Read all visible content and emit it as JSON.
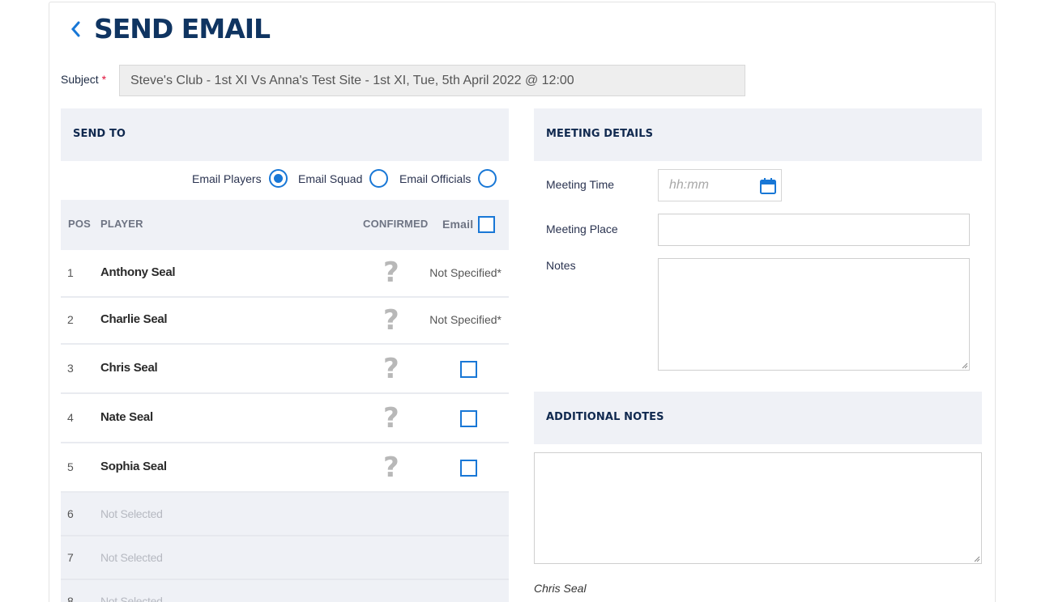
{
  "page": {
    "title": "SEND EMAIL"
  },
  "subject": {
    "label": "Subject",
    "required_mark": "*",
    "value": "Steve's Club - 1st XI Vs Anna's Test Site - 1st XI, Tue, 5th April 2022 @ 12:00"
  },
  "send_to": {
    "heading": "SEND TO",
    "options": [
      {
        "label": "Email Players",
        "selected": true
      },
      {
        "label": "Email Squad",
        "selected": false
      },
      {
        "label": "Email Officials",
        "selected": false
      }
    ],
    "columns": {
      "pos": "POS",
      "player": "PLAYER",
      "confirmed": "CONFIRMED",
      "email": "Email"
    },
    "rows": [
      {
        "pos": "1",
        "name": "Anthony Seal",
        "confirmed": "?",
        "email": "Not Specified*"
      },
      {
        "pos": "2",
        "name": "Charlie Seal",
        "confirmed": "?",
        "email": "Not Specified*"
      },
      {
        "pos": "3",
        "name": "Chris Seal",
        "confirmed": "?",
        "email": ""
      },
      {
        "pos": "4",
        "name": "Nate Seal",
        "confirmed": "?",
        "email": ""
      },
      {
        "pos": "5",
        "name": "Sophia Seal",
        "confirmed": "?",
        "email": ""
      },
      {
        "pos": "6",
        "name": "Not Selected"
      },
      {
        "pos": "7",
        "name": "Not Selected"
      },
      {
        "pos": "8",
        "name": "Not Selected"
      }
    ]
  },
  "meeting": {
    "heading": "MEETING DETAILS",
    "time_label": "Meeting Time",
    "time_placeholder": "hh:mm",
    "place_label": "Meeting Place",
    "place_value": "",
    "notes_label": "Notes",
    "notes_value": ""
  },
  "additional_notes": {
    "heading": "ADDITIONAL NOTES",
    "value": ""
  },
  "sender": {
    "name": "Chris Seal"
  },
  "colors": {
    "accent": "#1877d6",
    "title": "#0f3461",
    "panel_bg": "#eff1f6",
    "required": "#e0103a"
  }
}
